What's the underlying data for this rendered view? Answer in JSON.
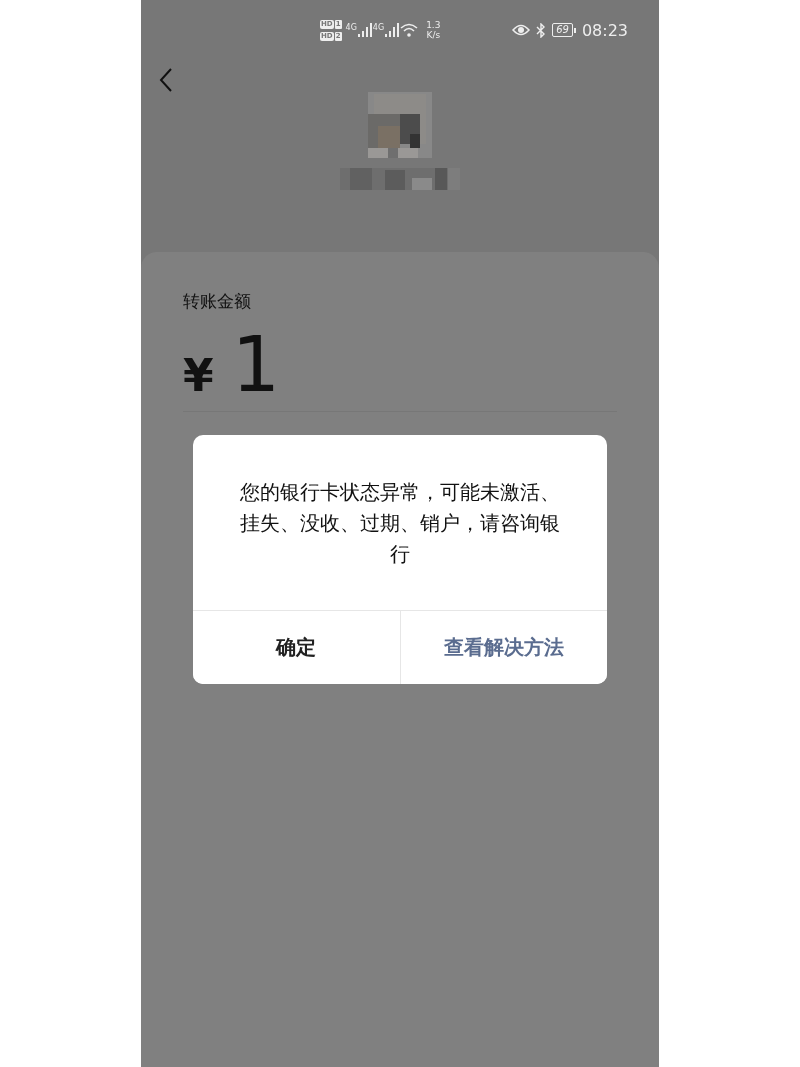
{
  "status_bar": {
    "sims": [
      {
        "hd": "HD",
        "slot": "1",
        "network": "4G"
      },
      {
        "hd": "HD",
        "slot": "2",
        "network": "4G"
      }
    ],
    "speed_value": "1.3",
    "speed_unit": "K/s",
    "battery": "69",
    "time": "08:23"
  },
  "transfer": {
    "label": "转账金额",
    "currency": "¥",
    "amount": "1"
  },
  "dialog": {
    "message": "您的银行卡状态异常，可能未激活、挂失、没收、过期、销户，请咨询银行",
    "buttons": [
      {
        "label": "确定",
        "kind": "confirm"
      },
      {
        "label": "查看解决方法",
        "kind": "link"
      }
    ]
  }
}
